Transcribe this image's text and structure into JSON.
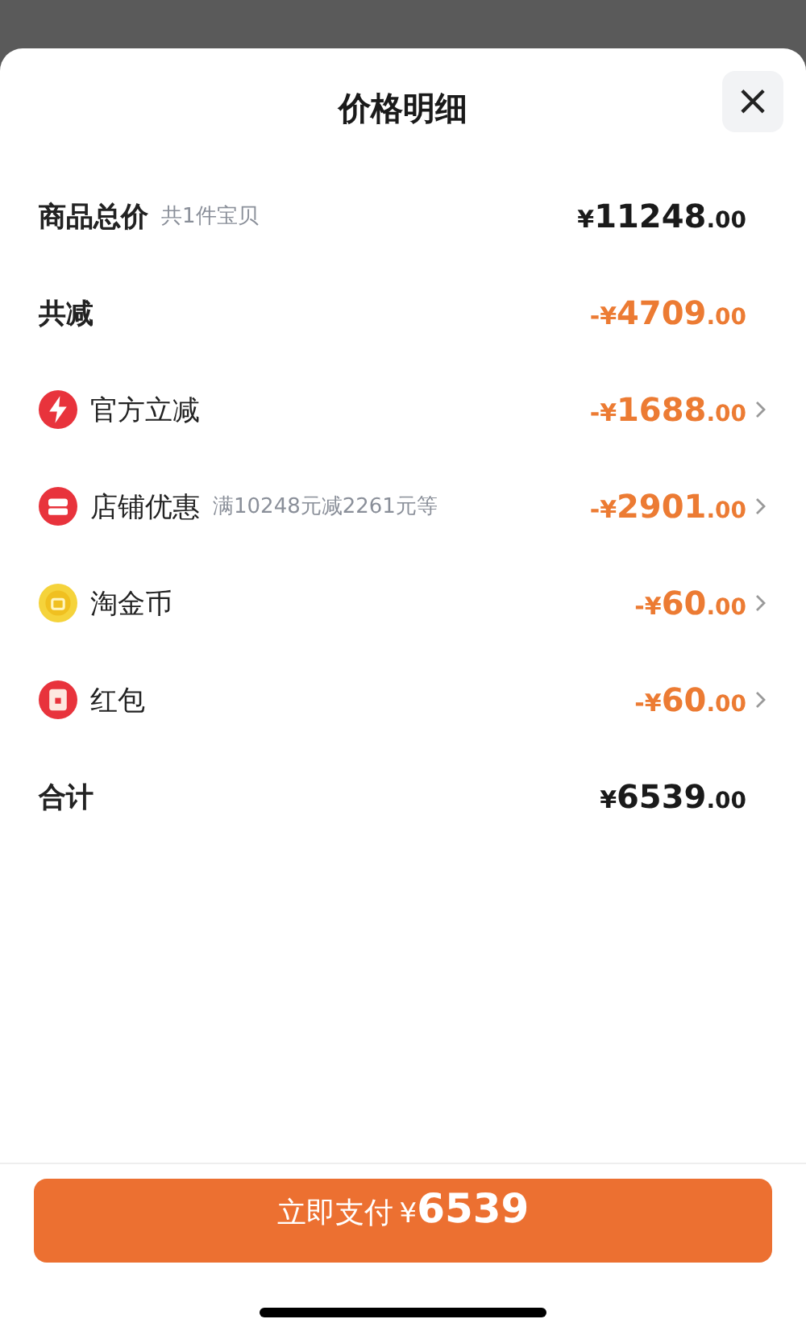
{
  "sheet": {
    "title": "价格明细",
    "close": "×"
  },
  "rows": [
    {
      "kind": "summary",
      "label": "商品总价",
      "note": "共1件宝贝",
      "discount": false,
      "amount": {
        "prefix": "¥",
        "main": "11248",
        "cents": ".00"
      }
    },
    {
      "kind": "summary",
      "label": "共减",
      "discount": true,
      "amount": {
        "prefix": "-¥",
        "main": "4709",
        "cents": ".00"
      }
    },
    {
      "kind": "bolt",
      "label": "官方立减",
      "discount": true,
      "amount": {
        "prefix": "-¥",
        "main": "1688",
        "cents": ".00"
      }
    },
    {
      "kind": "shop",
      "label": "店铺优惠",
      "note": "满10248元减2261元等",
      "discount": true,
      "amount": {
        "prefix": "-¥",
        "main": "2901",
        "cents": ".00"
      }
    },
    {
      "kind": "coin",
      "label": "淘金币",
      "discount": true,
      "amount": {
        "prefix": "-¥",
        "main": "60",
        "cents": ".00"
      }
    },
    {
      "kind": "envelope",
      "label": "红包",
      "discount": true,
      "amount": {
        "prefix": "-¥",
        "main": "60",
        "cents": ".00"
      }
    },
    {
      "kind": "summary",
      "label": "合计",
      "discount": false,
      "amount": {
        "prefix": "¥",
        "main": "6539",
        "cents": ".00"
      }
    }
  ],
  "pay_button": {
    "label": "立即支付",
    "prefix": "¥",
    "amount": "6539"
  }
}
